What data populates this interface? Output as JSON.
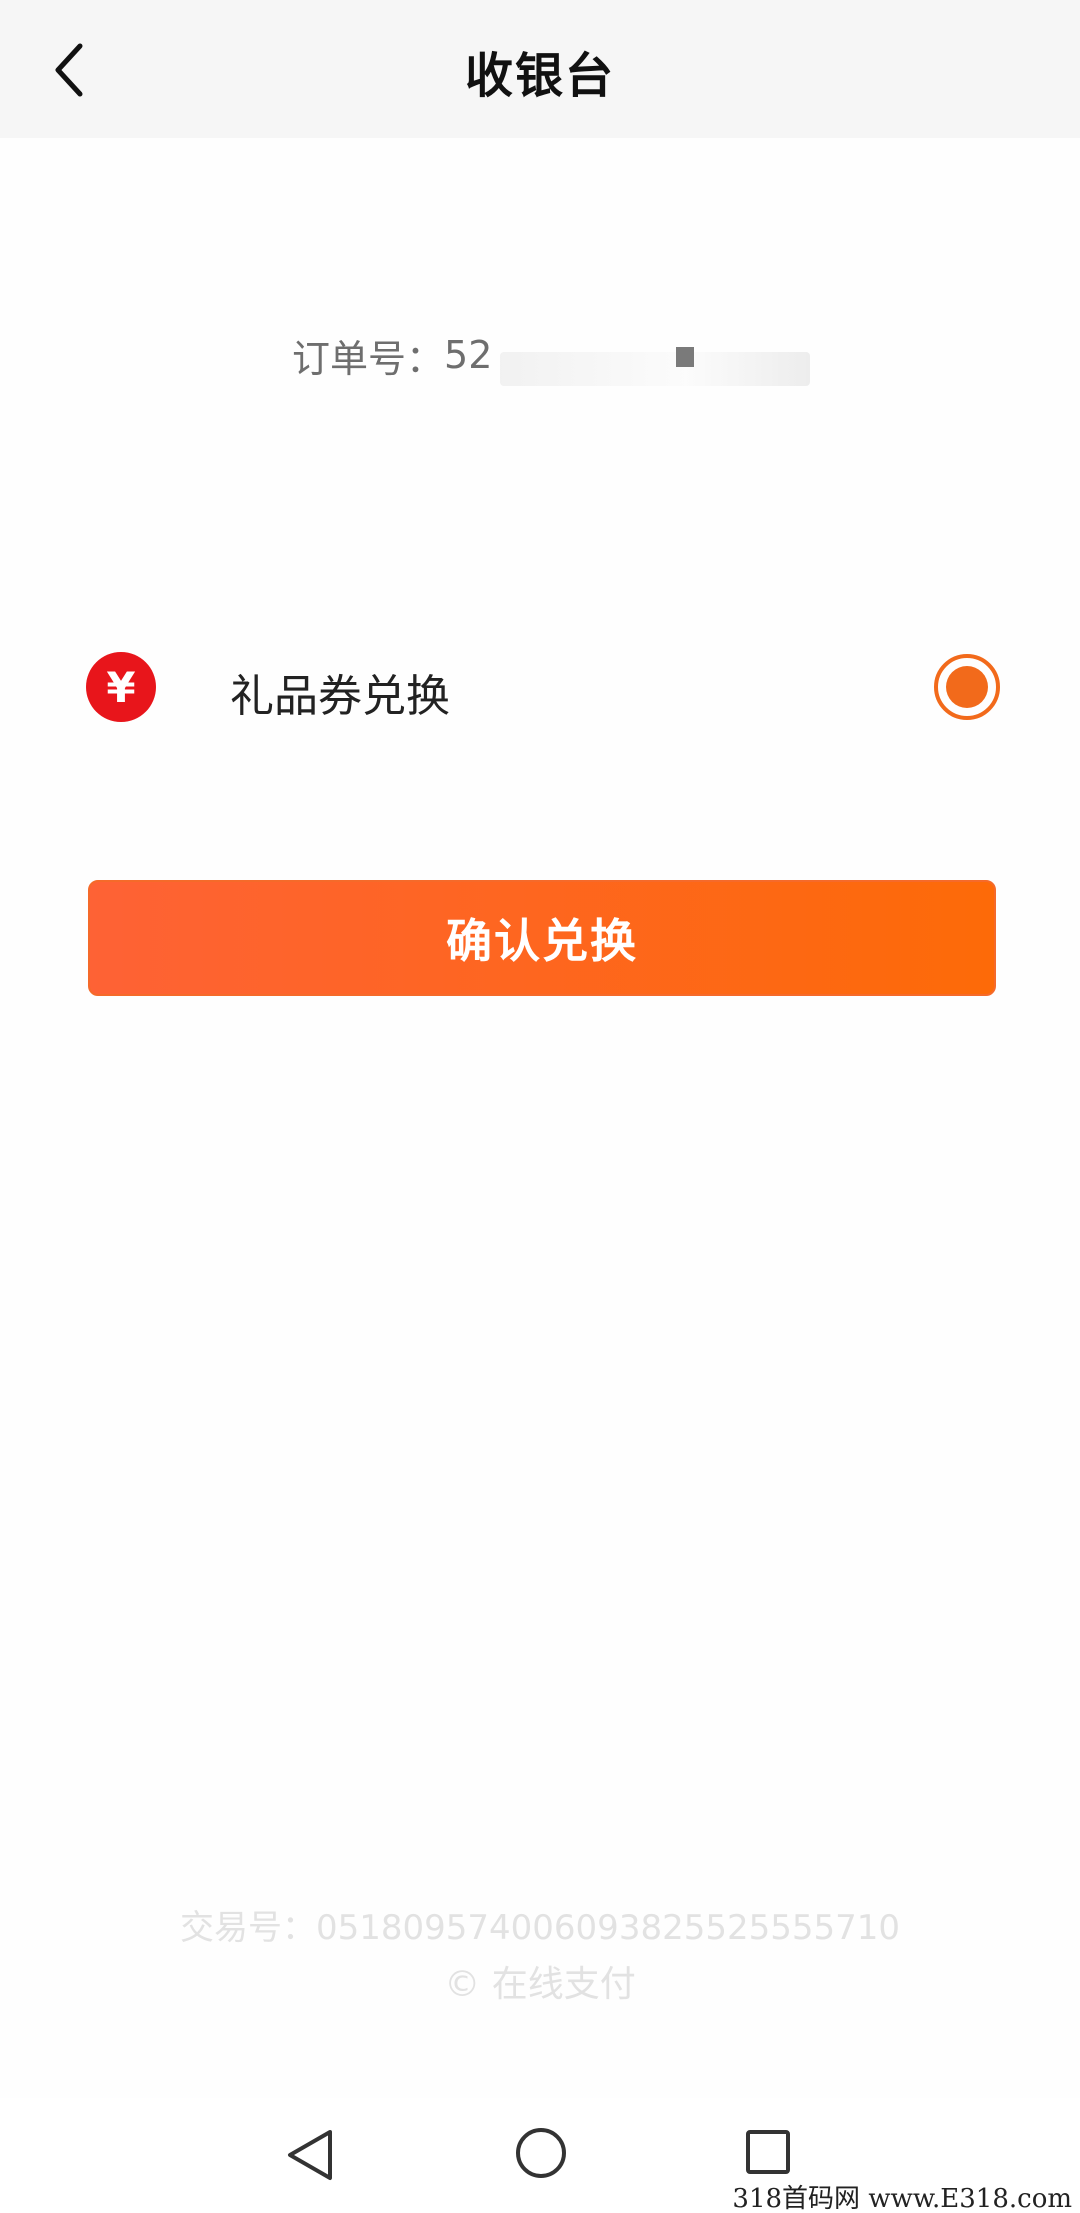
{
  "header": {
    "title": "收银台"
  },
  "order": {
    "label": "订单号：",
    "number_visible": "52"
  },
  "payment": {
    "option_label": "礼品券兑换",
    "icon_glyph": "¥",
    "selected": true,
    "accent_color": "#f26a1b"
  },
  "confirm": {
    "label": "确认兑换"
  },
  "footer": {
    "trade_no": "交易号：051809574006093825525555710",
    "online_pay": "© 在线支付"
  },
  "watermark": {
    "text": "318首码网  www.E318.com"
  }
}
